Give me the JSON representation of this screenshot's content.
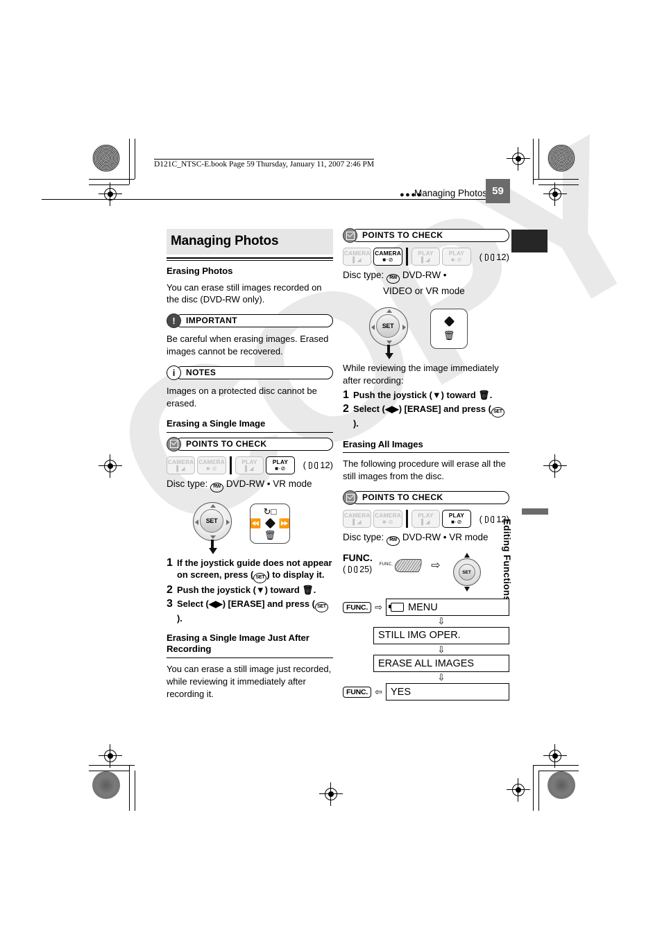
{
  "header": {
    "file_line": "D121C_NTSC-E.book  Page 59  Thursday, January 11, 2007  2:46 PM",
    "running_dots": "●●●●",
    "running_title": "Managing Photos",
    "page_number": "59"
  },
  "side_tab": {
    "label": "Editing Functions"
  },
  "watermark": {
    "text": "COPY"
  },
  "left": {
    "section_title": "Managing Photos",
    "erasing_photos": {
      "heading": "Erasing Photos",
      "body": "You can erase still images recorded on the disc (DVD-RW only)."
    },
    "important": {
      "label": "IMPORTANT",
      "icon": "exclamation-icon",
      "body": "Be careful when erasing images. Erased images cannot be recovered."
    },
    "notes": {
      "label": "NOTES",
      "icon": "info-icon",
      "body": "Images on a protected disc cannot be erased."
    },
    "single_image": {
      "heading": "Erasing a Single Image",
      "points_to_check": "POINTS TO CHECK",
      "modes": [
        {
          "name": "CAMERA",
          "sub": "ᴀ▶",
          "icon": "camcorder-icon",
          "active": false
        },
        {
          "name": "CAMERA",
          "sub": "●·⊘",
          "icon": "photo-icon",
          "active": false
        },
        {
          "name": "PLAY",
          "sub": "ᴀ▶",
          "icon": "camcorder-icon",
          "active": false
        },
        {
          "name": "PLAY",
          "sub": "●·⊘",
          "icon": "photo-icon",
          "active": true
        }
      ],
      "page_ref": "12",
      "disc_label": "Disc type:",
      "disc_glyph": "RW",
      "disc_value": "DVD-RW • VR mode",
      "joystick_guide_icons": [
        "rotate-icon",
        "prev-icon",
        "select-icon",
        "next-icon",
        "trash-icon"
      ],
      "steps": [
        {
          "n": "1",
          "parts": [
            "If the joystick guide does not appear on screen, press (",
            "SET",
            ") to display it."
          ]
        },
        {
          "n": "2",
          "parts": [
            "Push the joystick (",
            "▼",
            ") toward ",
            "trash-icon",
            "."
          ]
        },
        {
          "n": "3",
          "parts": [
            "Select (",
            "◀▶",
            ") [ERASE] and press (",
            "SET",
            ")."
          ]
        }
      ]
    },
    "just_after": {
      "heading": "Erasing a Single Image Just After Recording",
      "body": "You can erase a still image just recorded, while reviewing it immediately after recording it."
    }
  },
  "right": {
    "points_to_check": "POINTS TO CHECK",
    "modes_top": [
      {
        "name": "CAMERA",
        "sub": "ᴀ▶",
        "active": false
      },
      {
        "name": "CAMERA",
        "sub": "●·⊘",
        "active": true
      },
      {
        "name": "PLAY",
        "sub": "ᴀ▶",
        "active": false
      },
      {
        "name": "PLAY",
        "sub": "●·⊘",
        "active": false
      }
    ],
    "page_ref_top": "12",
    "disc_label_top": "Disc type:",
    "disc_glyph_top": "RW",
    "disc_value_top_1": "DVD-RW •",
    "disc_value_top_2": "VIDEO or VR mode",
    "intro": "While reviewing the image immediately after recording:",
    "steps": [
      {
        "n": "1",
        "text_a": "Push the joystick (",
        "arrow": "▼",
        "text_b": ") toward ",
        "icon": "trash-icon",
        "text_c": "."
      },
      {
        "n": "2",
        "text_a": "Select (",
        "arrow": "◀▶",
        "text_b": ") [ERASE] and press (",
        "set": "SET",
        "text_c": ")."
      }
    ],
    "erase_all": {
      "heading": "Erasing All Images",
      "body": "The following procedure will erase all the still images from the disc.",
      "points_to_check": "POINTS TO CHECK",
      "modes": [
        {
          "name": "CAMERA",
          "sub": "ᴀ▶",
          "active": false
        },
        {
          "name": "CAMERA",
          "sub": "●·⊘",
          "active": false
        },
        {
          "name": "PLAY",
          "sub": "ᴀ▶",
          "active": false
        },
        {
          "name": "PLAY",
          "sub": "●·⊘",
          "active": true
        }
      ],
      "page_ref": "12",
      "disc_label": "Disc type:",
      "disc_glyph": "RW",
      "disc_value": "DVD-RW • VR mode"
    },
    "func": {
      "label": "FUNC.",
      "page_ref": "25",
      "button_label": "FUNC.",
      "arrow": "⇨",
      "joystick_label": "SET",
      "flow": [
        {
          "key": "FUNC.",
          "key_arrow": "⇨",
          "icon": "camcorder-icon",
          "label": "MENU"
        },
        {
          "key": "",
          "key_arrow": "",
          "icon": "",
          "label": "STILL IMG OPER."
        },
        {
          "key": "",
          "key_arrow": "",
          "icon": "",
          "label": "ERASE ALL IMAGES"
        },
        {
          "key": "FUNC.",
          "key_arrow": "⇦",
          "icon": "",
          "label": "YES"
        }
      ],
      "down_arrow": "⇩"
    }
  }
}
